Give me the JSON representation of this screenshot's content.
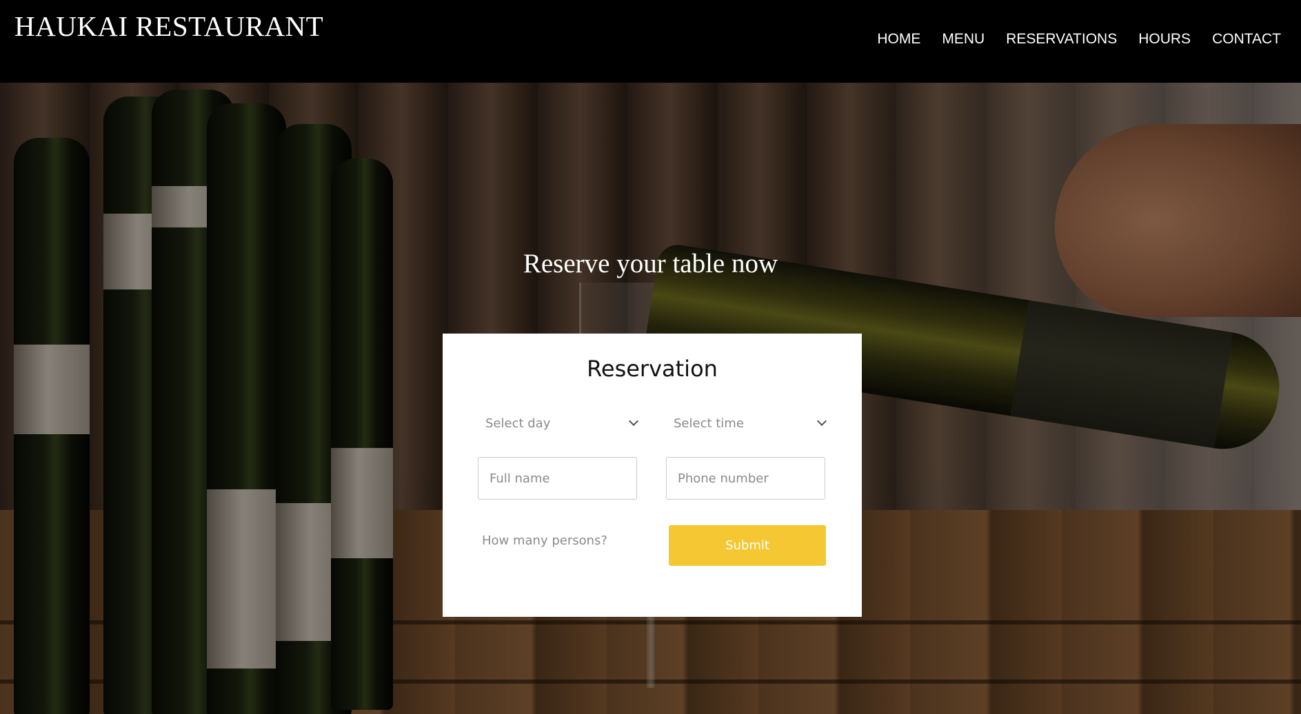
{
  "header": {
    "brand": "HAUKAI RESTAURANT",
    "nav": [
      {
        "label": "HOME"
      },
      {
        "label": "MENU"
      },
      {
        "label": "RESERVATIONS"
      },
      {
        "label": "HOURS"
      },
      {
        "label": "CONTACT"
      }
    ]
  },
  "hero": {
    "title": "Reserve your table now"
  },
  "reservation": {
    "title": "Reservation",
    "day_select": "Select day",
    "time_select": "Select time",
    "name_placeholder": "Full name",
    "phone_placeholder": "Phone number",
    "persons_select": "How many persons?",
    "submit_label": "Submit"
  },
  "colors": {
    "header_bg": "#000000",
    "submit_bg": "#f5c733",
    "card_bg": "#ffffff"
  }
}
